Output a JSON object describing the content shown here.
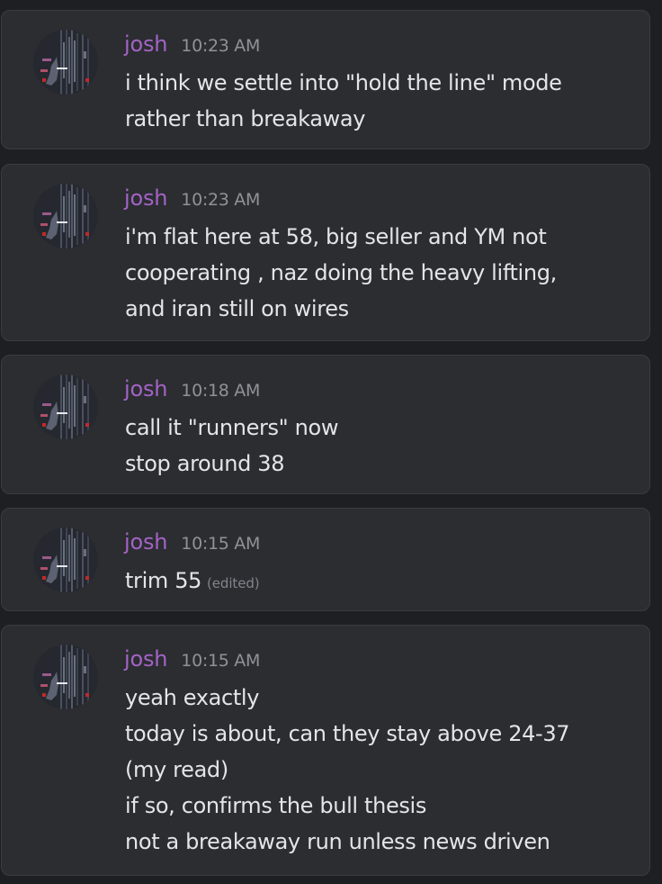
{
  "accent_colors": {
    "username": "#a463c5",
    "message_text": "#e3e5e8",
    "timestamp": "#8f9298",
    "card_background": "#2b2d31",
    "page_background": "#1e1f22"
  },
  "messages": [
    {
      "username": "josh",
      "time": "10:23 AM",
      "lines": [
        "i think we settle into \"hold the line\" mode",
        "rather than breakaway"
      ]
    },
    {
      "username": "josh",
      "time": "10:23 AM",
      "lines": [
        "i'm flat here at 58, big seller and YM not",
        "cooperating , naz doing the heavy lifting,",
        "and iran still on wires"
      ]
    },
    {
      "username": "josh",
      "time": "10:18 AM",
      "lines": [
        "call it \"runners\" now",
        "stop around 38"
      ]
    },
    {
      "username": "josh",
      "time": "10:15 AM",
      "lines": [
        "trim 55"
      ],
      "edited_label": "(edited)"
    },
    {
      "username": "josh",
      "time": "10:15 AM",
      "lines": [
        "yeah exactly",
        "today is about, can they stay above 24-37",
        "(my read)",
        "if so, confirms the bull thesis",
        "not a breakaway run unless news driven"
      ]
    }
  ]
}
